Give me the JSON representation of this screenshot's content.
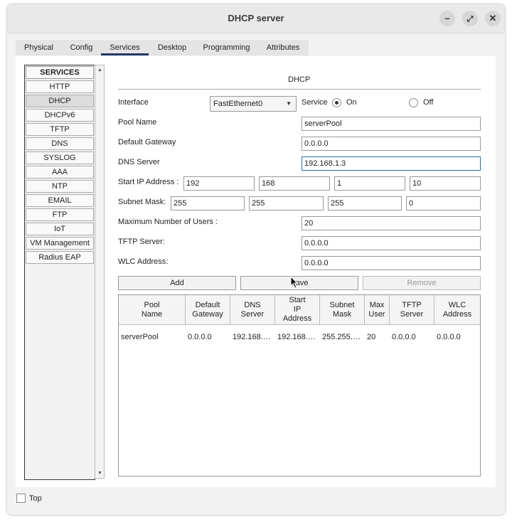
{
  "window": {
    "title": "DHCP server"
  },
  "tabs": [
    "Physical",
    "Config",
    "Services",
    "Desktop",
    "Programming",
    "Attributes"
  ],
  "services": {
    "header": "SERVICES",
    "items": [
      "HTTP",
      "DHCP",
      "DHCPv6",
      "TFTP",
      "DNS",
      "SYSLOG",
      "AAA",
      "NTP",
      "EMAIL",
      "FTP",
      "IoT",
      "VM Management",
      "Radius EAP"
    ],
    "selected": "DHCP"
  },
  "dhcp": {
    "title": "DHCP",
    "interface_label": "Interface",
    "interface_value": "FastEthernet0",
    "service_label": "Service",
    "on_label": "On",
    "off_label": "Off",
    "pool_name_label": "Pool Name",
    "pool_name_value": "serverPool",
    "gateway_label": "Default Gateway",
    "gateway_value": "0.0.0.0",
    "dns_label": "DNS Server",
    "dns_value": "192.168.1.3",
    "start_ip_label": "Start IP Address :",
    "start_ip": [
      "192",
      "168",
      "1",
      "10"
    ],
    "subnet_label": "Subnet Mask:",
    "subnet": [
      "255",
      "255",
      "255",
      "0"
    ],
    "max_users_label": "Maximum Number of Users :",
    "max_users_value": "20",
    "tftp_label": "TFTP Server:",
    "tftp_value": "0.0.0.0",
    "wlc_label": "WLC Address:",
    "wlc_value": "0.0.0.0",
    "add_label": "Add",
    "save_label": "Save",
    "remove_label": "Remove"
  },
  "table": {
    "headers": [
      "Pool\nName",
      "Default\nGateway",
      "DNS\nServer",
      "Start\nIP\nAddress",
      "Subnet\nMask",
      "Max\nUser",
      "TFTP\nServer",
      "WLC\nAddress"
    ],
    "rows": [
      [
        "serverPool",
        "0.0.0.0",
        "192.168.…",
        "192.168.…",
        "255.255.…",
        "20",
        "0.0.0.0",
        "0.0.0.0"
      ]
    ]
  },
  "footer": {
    "top_label": "Top"
  }
}
